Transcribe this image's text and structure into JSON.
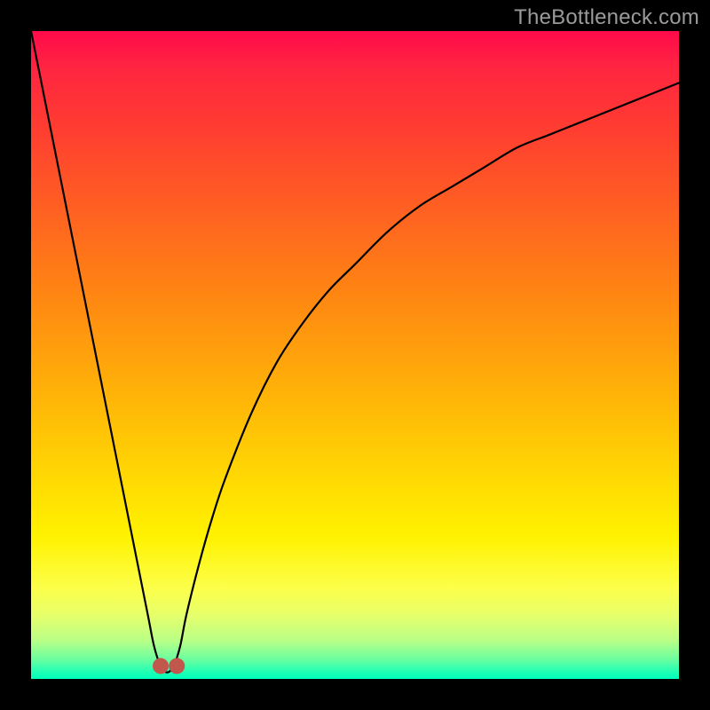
{
  "attribution": "TheBottleneck.com",
  "colors": {
    "frame_bg": "#000000",
    "gradient_top": "#ff0a4a",
    "gradient_bottom": "#00ffbb",
    "curve_stroke": "#000000",
    "marker_fill": "#c1574d",
    "attribution_text": "#9a9a9a"
  },
  "chart_data": {
    "type": "line",
    "title": "",
    "xlabel": "",
    "ylabel": "",
    "xlim": [
      0,
      100
    ],
    "ylim": [
      0,
      100
    ],
    "grid": false,
    "legend": false,
    "series": [
      {
        "name": "bottleneck-curve",
        "x": [
          0,
          2,
          4,
          6,
          8,
          10,
          12,
          14,
          16,
          18,
          19,
          20,
          21,
          22,
          23,
          24,
          26,
          28,
          30,
          34,
          38,
          42,
          46,
          50,
          55,
          60,
          65,
          70,
          75,
          80,
          85,
          90,
          95,
          100
        ],
        "values": [
          100,
          90,
          80,
          70,
          60,
          50,
          40,
          30,
          20,
          10,
          5,
          2,
          1,
          2,
          5,
          10,
          18,
          25,
          31,
          41,
          49,
          55,
          60,
          64,
          69,
          73,
          76,
          79,
          82,
          84,
          86,
          88,
          90,
          92
        ]
      }
    ],
    "markers": [
      {
        "name": "minimum-left",
        "x": 20,
        "y": 2
      },
      {
        "name": "minimum-right",
        "x": 22.5,
        "y": 2
      }
    ]
  }
}
